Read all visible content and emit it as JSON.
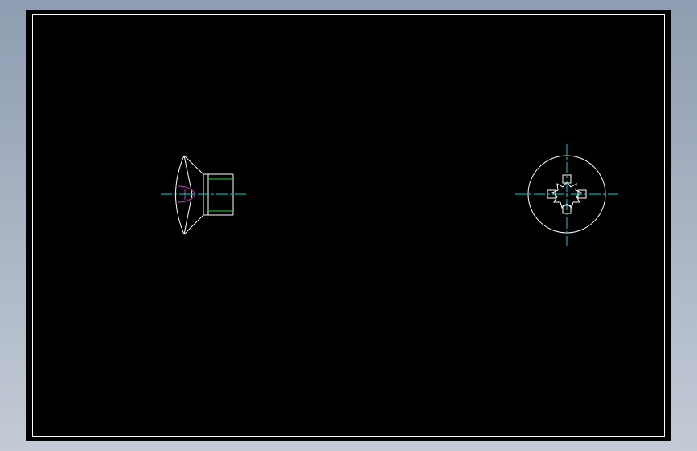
{
  "canvas": {
    "background_color": "#000000",
    "outer_background": "#a7b3c3"
  },
  "colors": {
    "geometry": "#ffffff",
    "centerline": "#00d2d2",
    "hidden_detail": "#cc33cc",
    "thread": "#33cc33"
  },
  "drawing": {
    "views": [
      {
        "name": "side-view",
        "description_icon": "countersunk-screw-side-view"
      },
      {
        "name": "top-view",
        "description_icon": "torx-screw-head-top-view"
      }
    ]
  }
}
